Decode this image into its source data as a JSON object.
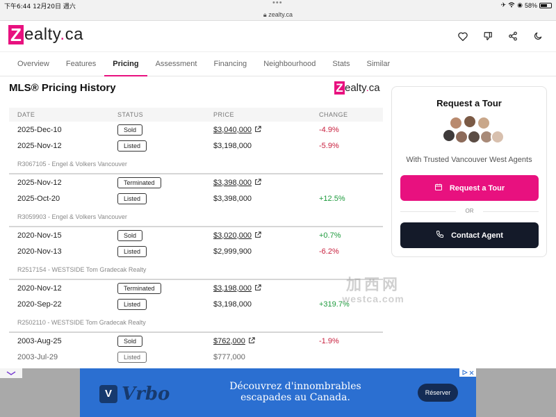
{
  "status_bar": {
    "time": "下午6:44",
    "date": "12月20日 週六",
    "battery": "58%"
  },
  "url": "zealty.ca",
  "header": {
    "logo_z": "Z",
    "logo_rest": "ealty",
    "logo_dot": ".",
    "logo_tld": "ca"
  },
  "tabs": [
    {
      "label": "Overview"
    },
    {
      "label": "Features"
    },
    {
      "label": "Pricing"
    },
    {
      "label": "Assessment"
    },
    {
      "label": "Financing"
    },
    {
      "label": "Neighbourhood"
    },
    {
      "label": "Stats"
    },
    {
      "label": "Similar"
    }
  ],
  "active_tab": "Pricing",
  "page_title": "MLS® Pricing History",
  "table": {
    "headers": {
      "date": "DATE",
      "status": "STATUS",
      "price": "PRICE",
      "change": "CHANGE"
    },
    "groups": [
      {
        "rows": [
          {
            "date": "2025-Dec-10",
            "status": "Sold",
            "price": "$3,040,000",
            "link": true,
            "change": "-4.9%"
          },
          {
            "date": "2025-Nov-12",
            "status": "Listed",
            "price": "$3,198,000",
            "link": false,
            "change": "-5.9%"
          }
        ],
        "mls": "R3067105 - Engel & Volkers Vancouver"
      },
      {
        "rows": [
          {
            "date": "2025-Nov-12",
            "status": "Terminated",
            "price": "$3,398,000",
            "link": true,
            "change": ""
          },
          {
            "date": "2025-Oct-20",
            "status": "Listed",
            "price": "$3,398,000",
            "link": false,
            "change": "+12.5%"
          }
        ],
        "mls": "R3059903 - Engel & Volkers Vancouver"
      },
      {
        "rows": [
          {
            "date": "2020-Nov-15",
            "status": "Sold",
            "price": "$3,020,000",
            "link": true,
            "change": "+0.7%"
          },
          {
            "date": "2020-Nov-13",
            "status": "Listed",
            "price": "$2,999,900",
            "link": false,
            "change": "-6.2%"
          }
        ],
        "mls": "R2517154 - WESTSIDE Tom Gradecak Realty"
      },
      {
        "rows": [
          {
            "date": "2020-Nov-12",
            "status": "Terminated",
            "price": "$3,198,000",
            "link": true,
            "change": ""
          },
          {
            "date": "2020-Sep-22",
            "status": "Listed",
            "price": "$3,198,000",
            "link": false,
            "change": "+319.7%"
          }
        ],
        "mls": "R2502110 - WESTSIDE Tom Gradecak Realty"
      },
      {
        "rows": [
          {
            "date": "2003-Aug-25",
            "status": "Sold",
            "price": "$762,000",
            "link": true,
            "change": "-1.9%"
          },
          {
            "date": "2003-Jul-29",
            "status": "Listed",
            "price": "$777,000",
            "link": false,
            "change": ""
          }
        ]
      }
    ]
  },
  "tour": {
    "title": "Request a Tour",
    "subtitle": "With Trusted Vancouver West Agents",
    "request_button": "Request a Tour",
    "or_label": "OR",
    "contact_button": "Contact Agent"
  },
  "watermark": {
    "cn": "加西网",
    "en": "westca.com"
  },
  "ad": {
    "brand": "Vrbo",
    "headline_1": "Découvrez d'innombrables",
    "headline_2": "escapades au Canada.",
    "cta": "Réserver"
  },
  "colors": {
    "brand_pink": "#e8117f",
    "negative": "#c81e3c",
    "positive": "#1d9a3c",
    "dark_button": "#141a29",
    "ad_blue": "#2b6fd1"
  }
}
